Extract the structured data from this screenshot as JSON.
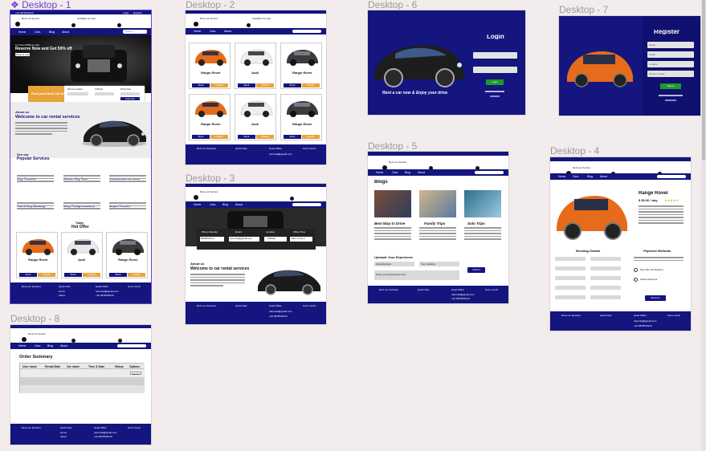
{
  "frames": {
    "d1": "Desktop - 1",
    "d2": "Desktop - 2",
    "d3": "Desktop - 3",
    "d4": "Desktop - 4",
    "d5": "Desktop - 5",
    "d6": "Desktop - 6",
    "d7": "Desktop - 7",
    "d8": "Desktop - 8"
  },
  "site": {
    "topbar_phone": "+91 9876543210",
    "topbar_login": "Login",
    "topbar_register": "Register",
    "brand": "Rent our Service",
    "help": "Available for Help",
    "nav": [
      "Home",
      "Cars",
      "Blog",
      "About"
    ],
    "search_placeholder": "Search"
  },
  "d1": {
    "hero_small": "For Rent 250$ per day",
    "hero_big": "Reserve Now and Get 50% off",
    "hero_btn": "Reserve now",
    "find_title": "Find your Best Car Here",
    "find_fields": [
      "Pick Up Location",
      "# Wheels",
      "Pickup Date"
    ],
    "find_btn": "Find Car",
    "about_small": "About us",
    "about_title": "Welcome to car rental services",
    "see_our": "See our",
    "popular": "Popular Services",
    "services": [
      "City Transfer",
      "Whole City Tour",
      "Unlimited Miles Car Rental",
      "Fast & Easy Booking",
      "Many Pickup Locations",
      "Airport Transfer"
    ],
    "hot_today": "Today",
    "hot_offer": "Hot Offer",
    "cars": [
      "Range Rover",
      "Audi",
      "Range Rover"
    ],
    "book": "Book",
    "details": "Details"
  },
  "d2": {
    "cars": [
      "Range Rover",
      "Audi",
      "Range Rover",
      "Range Rover",
      "Audi",
      "Range Rover"
    ]
  },
  "d3": {
    "fields": [
      "Phone Number",
      "Email",
      "Location",
      "Office Time"
    ],
    "values": [
      "8529663214",
      "carrental@gmail.com",
      "Kolkata",
      "9am to 8 pm"
    ],
    "about_small": "About us",
    "about_title": "Welcome to car rental services"
  },
  "d4": {
    "title": "Range Rover",
    "price": "$ 50.00 / day",
    "booking": "Booking Details",
    "payment": "Payment Methods",
    "pay_options": [
      "Pay After car Delivery",
      "Online Payment"
    ],
    "reserve": "Reserve"
  },
  "d5": {
    "heading": "Blogs",
    "posts": [
      "Best Way to Drive",
      "Family Trips",
      "Solo Trips"
    ],
    "upload_title": "Uploade Your Experience",
    "upload_fields": [
      "Upload picture",
      "Your heading",
      "Share your Experience here"
    ],
    "submit": "Submit"
  },
  "d6": {
    "login": "Login",
    "tagline": "Rent a car now & Enjoy your drive",
    "login_btn": "Login"
  },
  "d7": {
    "register": "Register",
    "fields": [
      "Name",
      "Email",
      "Location",
      "Phone number"
    ],
    "signup": "Signup"
  },
  "d8": {
    "title": "Order Summary",
    "columns": [
      "User name",
      "Rental Date",
      "Car name",
      "Time & Date",
      "Status",
      "Options"
    ],
    "cancel": "Cancel"
  },
  "footer": {
    "cols": [
      "Rent our Services",
      "Quick links",
      "Head Office",
      "Get in touch"
    ],
    "links": [
      "Home",
      "About",
      "Privacy Policy"
    ],
    "email": "carrental@gmail.com",
    "phone": "+91 9876543210"
  },
  "colors": {
    "navy": "#14157f",
    "accent_orange": "#e8a43a",
    "green": "#1c9a2a",
    "label_selected": "#6b3fd6"
  }
}
